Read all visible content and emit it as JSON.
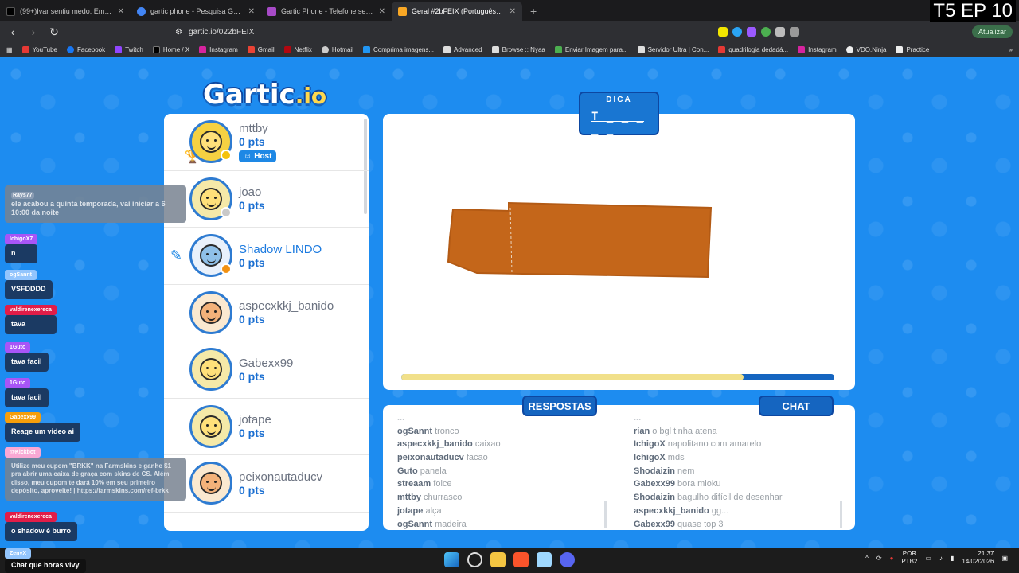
{
  "episode_label": "T5 EP 10",
  "tabs": [
    {
      "label": "(99+)Ivar sentiu medo: Emocionante",
      "color": "#000000"
    },
    {
      "label": "gartic phone - Pesquisa Google",
      "color": "#4285f4"
    },
    {
      "label": "Gartic Phone - Telefone sem fio",
      "color": "#a74ac7"
    },
    {
      "label": "Geral #2bFEIX (Português) - Gart",
      "color": "#f9a825",
      "active": true
    }
  ],
  "address": {
    "url": "gartic.io/022bFEIX",
    "update_label": "Atualizar"
  },
  "bookmarks": [
    "YouTube",
    "Facebook",
    "Twitch",
    "Home / X",
    "Instagram",
    "Gmail",
    "Netflix",
    "Hotmail",
    "Comprima imagens...",
    "Advanced",
    "Browse :: Nyaa",
    "Enviar Imagem para...",
    "Servidor Ultra | Con...",
    "quadrilogia dedadá...",
    "Instagram",
    "VDO.Ninja",
    "Practice"
  ],
  "logo": {
    "main": "Gartic",
    "suffix": ".io"
  },
  "hint": {
    "title": "DICA",
    "word": "T _ _ _ _ _"
  },
  "players": [
    {
      "name": "mttby",
      "points": "0 pts",
      "host": "Host",
      "dot": "#f4c20d",
      "skin": "",
      "crown": true
    },
    {
      "name": "joao",
      "points": "0 pts",
      "dot": "#c9c9c9",
      "skin": ""
    },
    {
      "name": "Shadow LINDO",
      "points": "0 pts",
      "dot": "#f29111",
      "skin": "skin3",
      "drawing": true
    },
    {
      "name": "aspecxkkj_banido",
      "points": "0 pts",
      "skin": "skin2"
    },
    {
      "name": "Gabexx99",
      "points": "0 pts",
      "skin": ""
    },
    {
      "name": "jotape",
      "points": "0 pts",
      "skin": ""
    },
    {
      "name": "peixonautaducv",
      "points": "0 pts",
      "skin": "skin2"
    }
  ],
  "timer": {
    "progress": 0.79
  },
  "answers_label": "RESPOSTAS",
  "chat_label": "CHAT",
  "answers": [
    {
      "who": "ogSannt",
      "text": "tronco"
    },
    {
      "who": "aspecxkkj_banido",
      "text": "caixao"
    },
    {
      "who": "peixonautaducv",
      "text": "facao"
    },
    {
      "who": "Guto",
      "text": "panela"
    },
    {
      "who": "streaam",
      "text": "foice"
    },
    {
      "who": "mttby",
      "text": "churrasco"
    },
    {
      "who": "jotape",
      "text": "alça"
    },
    {
      "who": "ogSannt",
      "text": "madeira"
    }
  ],
  "chat": [
    {
      "who": "rian",
      "text": "o bgl tinha atena"
    },
    {
      "who": "IchigoX",
      "text": "napolitano com amarelo"
    },
    {
      "who": "IchigoX",
      "text": "mds"
    },
    {
      "who": "Shodaizin",
      "text": "nem"
    },
    {
      "who": "Gabexx99",
      "text": "bora mioku"
    },
    {
      "who": "Shodaizin",
      "text": "bagulho difícil de desenhar"
    },
    {
      "who": "aspecxkkj_banido",
      "text": "gg..."
    },
    {
      "who": "Gabexx99",
      "text": "quase top 3"
    }
  ],
  "stream_chat": [
    {
      "user": "Rays77",
      "text": "ele acabou a quinta temporada, vai iniciar a 6 10:00 da noite",
      "tag": "#8a9cb3",
      "grey": true
    },
    {
      "user": "IchigoX7",
      "text": "n",
      "tag": "#a855f7"
    },
    {
      "user": "ogSannt",
      "text": "VSFDDDD",
      "tag": "#93c5fd"
    },
    {
      "user": "valdirenexereca",
      "text": "tava",
      "tag": "#e11d48"
    },
    {
      "user": "1Guto",
      "text": "tava facil",
      "tag": "#a855f7"
    },
    {
      "user": "1Guto",
      "text": "tava facil",
      "tag": "#a855f7"
    },
    {
      "user": "Gabexx99",
      "text": "Reage um video ai",
      "tag": "#f59e0b"
    },
    {
      "user": "@Kickbot",
      "text": "Utilize meu cupom \"BRKK\" na Farmskins e ganhe $1 pra abrir uma caixa de graça com skins de CS. Além disso, meu cupom te dará 10% em seu primeiro depósito, aproveite! | https://farmskins.com/ref-brkk",
      "tag": "#f9a8d4",
      "grey": true
    },
    {
      "user": "valdirenexereca",
      "text": "o shadow é burro",
      "tag": "#e11d48"
    },
    {
      "user": "ZenvX",
      "text": "Chat que horas vivy",
      "tag": "#93c5fd"
    }
  ],
  "taskbar": {
    "lang": "POR",
    "layout": "PTB2",
    "time": "21:37",
    "date": "14/02/2026"
  }
}
